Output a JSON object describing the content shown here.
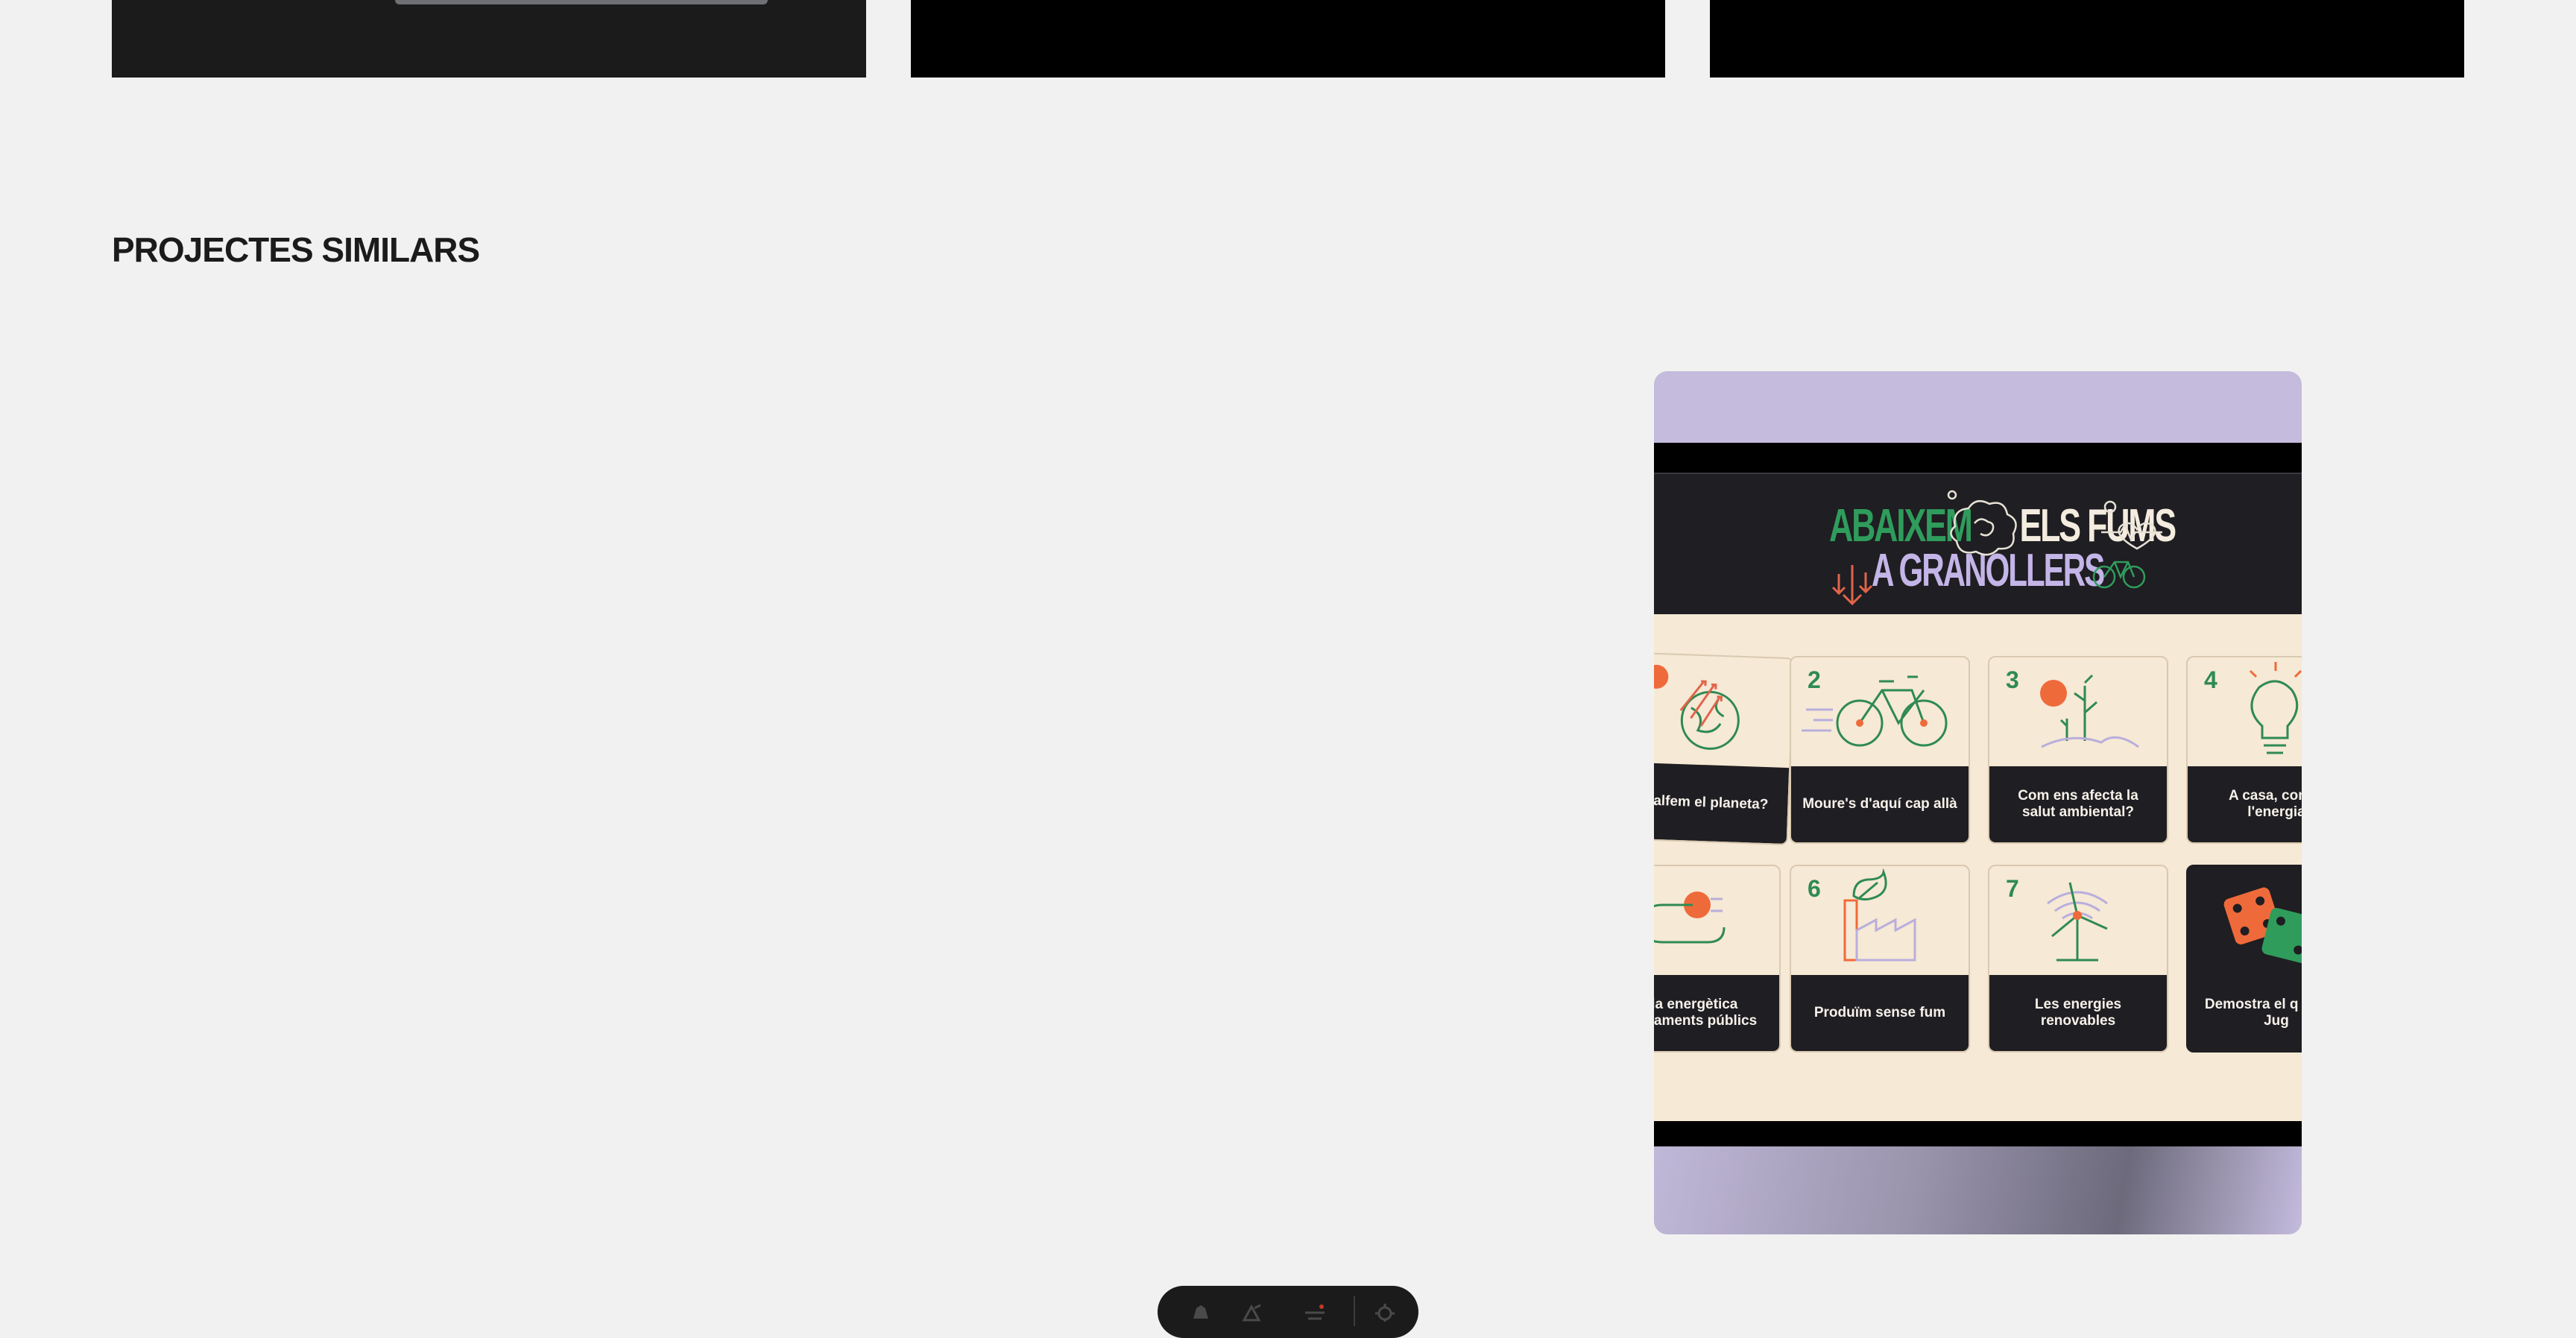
{
  "section": {
    "title": "PROJECTES SIMILARS"
  },
  "project_card": {
    "logo": {
      "line1_a": "ABAIXEM",
      "line1_b": "ELS FUMS",
      "line2": "A GRANOLLERS"
    },
    "themes": [
      {
        "number": "",
        "label": "escalfem el planeta?"
      },
      {
        "number": "2",
        "label": "Moure's d'aquí cap allà"
      },
      {
        "number": "3",
        "label": "Com ens afecta la salut ambiental?"
      },
      {
        "number": "4",
        "label": "A casa, compt l'energia"
      },
      {
        "number": "",
        "label": "cia energètica quipaments públics"
      },
      {
        "number": "6",
        "label": "Produïm sense fum"
      },
      {
        "number": "7",
        "label": "Les energies renovables"
      },
      {
        "number": "",
        "label": "Demostra el q après i Jug"
      }
    ]
  },
  "colors": {
    "page_bg": "#f1f1f1",
    "card_bg": "#c4bbdd",
    "green": "#2f9c5c",
    "lavender": "#c4b5e8",
    "orange": "#ef6a3a",
    "cream": "#f6e9d5"
  },
  "toolbar": {
    "icons": [
      "pen-icon",
      "shapes-icon",
      "sliders-icon",
      "settings-icon"
    ]
  }
}
